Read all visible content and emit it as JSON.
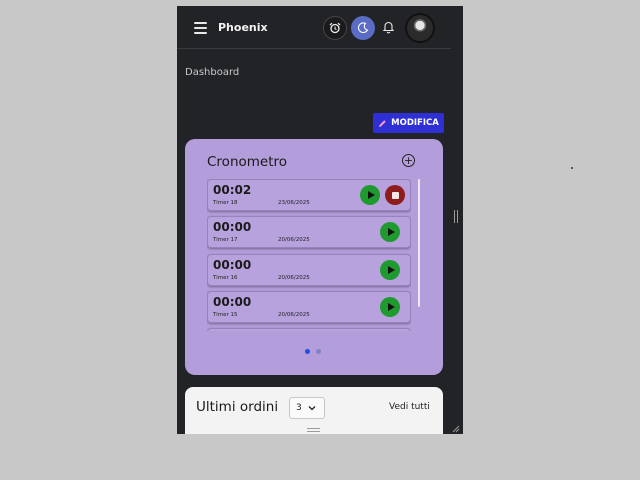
{
  "header": {
    "app_name": "Phoenix",
    "icons": [
      "menu-icon",
      "alarm-clock-icon",
      "moon-icon",
      "bell-icon",
      "avatar"
    ]
  },
  "breadcrumb": "Dashboard",
  "toolbar": {
    "edit_label": "MODIFICA"
  },
  "stopwatch": {
    "title": "Cronometro",
    "timers": [
      {
        "time": "00:02",
        "label": "Timer 18",
        "date": "23/06/2025",
        "running": true
      },
      {
        "time": "00:00",
        "label": "Timer 17",
        "date": "20/06/2025",
        "running": false
      },
      {
        "time": "00:00",
        "label": "Timer 16",
        "date": "20/06/2025",
        "running": false
      },
      {
        "time": "00:00",
        "label": "Timer 15",
        "date": "20/06/2025",
        "running": false
      }
    ],
    "pages": 2,
    "active_page": 1
  },
  "orders": {
    "title": "Ultimi ordini",
    "count_selected": "3",
    "view_all_label": "Vedi tutti"
  },
  "colors": {
    "app_background": "#222326",
    "card_purple": "#b39ddb",
    "edit_button": "#2f2fd6",
    "play_green": "#1f9a2f",
    "stop_red": "#8f1c1c",
    "moon_button": "#5b6cc4"
  }
}
